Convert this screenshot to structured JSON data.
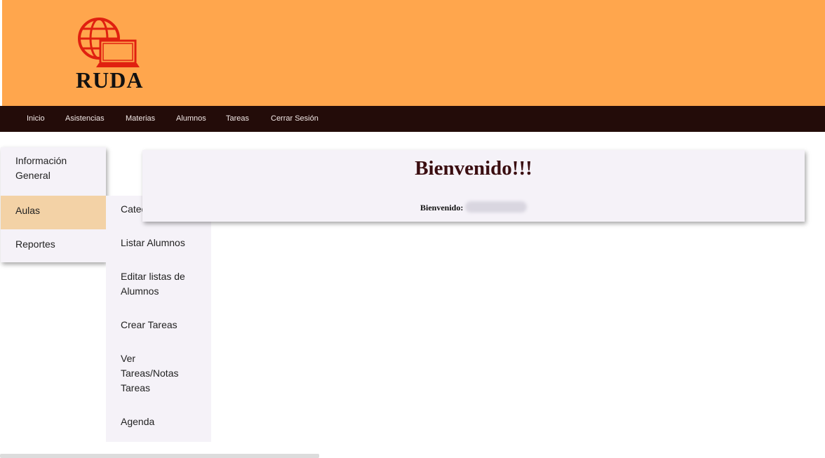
{
  "brand": {
    "name": "RUDA",
    "logo_icon": "globe-laptop-icon",
    "accent_color": "#ffa64d"
  },
  "nav": {
    "items": [
      "Inicio",
      "Asistencias",
      "Materias",
      "Alumnos",
      "Tareas",
      "Cerrar Sesión"
    ]
  },
  "sidebar": {
    "items": [
      {
        "label": "Información General"
      },
      {
        "label": "Aulas"
      },
      {
        "label": "Reportes"
      }
    ],
    "active_item": "Aulas"
  },
  "submenu": {
    "items": [
      {
        "label": "Catedras/Notas"
      },
      {
        "label": "Listar Alumnos"
      },
      {
        "label": "Editar listas de Alumnos"
      },
      {
        "label": "Crear Tareas"
      },
      {
        "label": "Ver Tareas/Notas Tareas"
      },
      {
        "label": "Agenda"
      }
    ]
  },
  "welcome": {
    "title": "Bienvenido!!!",
    "label": "Bienvenido:"
  }
}
